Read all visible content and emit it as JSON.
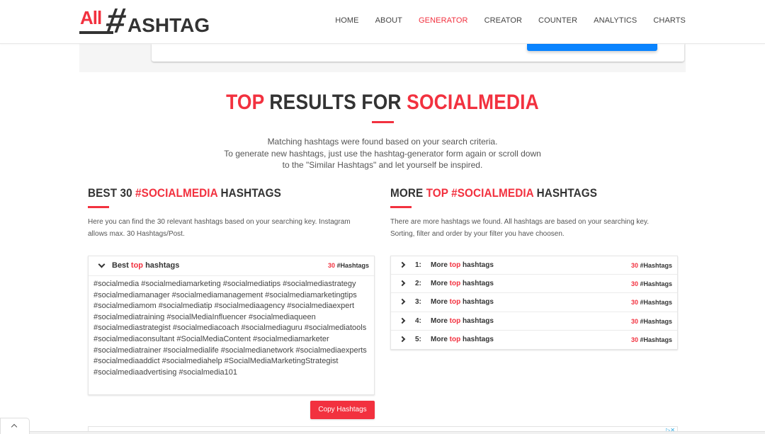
{
  "header": {
    "logo": {
      "all": "All",
      "hash": "#",
      "rest": "ASHTAG"
    },
    "nav": [
      {
        "label": "HOME",
        "active": false
      },
      {
        "label": "ABOUT",
        "active": false
      },
      {
        "label": "GENERATOR",
        "active": true
      },
      {
        "label": "CREATOR",
        "active": false
      },
      {
        "label": "COUNTER",
        "active": false
      },
      {
        "label": "ANALYTICS",
        "active": false
      },
      {
        "label": "CHARTS",
        "active": false
      }
    ]
  },
  "main": {
    "title": {
      "part1": "TOP",
      "part2": " RESULTS FOR ",
      "part3": "SOCIALMEDIA"
    },
    "intro": {
      "line1": "Matching hashtags were found based on your search criteria.",
      "line2": "To generate new hashtags, just use the hashtag-generator form again or scroll down",
      "line3": "to the \"Similar Hashtags\" and let yourself be inspired."
    }
  },
  "best": {
    "title": {
      "part1": "BEST 30 ",
      "part2": "#SOCIALMEDIA",
      "part3": " HASHTAGS"
    },
    "description": "Here you can find the 30 relevant hashtags based on your searching key. Instagram allows max. 30 Hashtags/Post.",
    "box": {
      "label": {
        "part1": "Best ",
        "part2": "top",
        "part3": " hashtags"
      },
      "count": "30",
      "count_suffix": " #Hashtags",
      "tags": "#socialmedia #socialmediamarketing #socialmediatips #socialmediastrategy #socialmediamanager #socialmediamanagement #socialmediamarketingtips #socialmediamom #socialmediatip #socialmediaagency #socialmediaexpert #socialmediatraining #socialMediaInfluencer #socialmediaqueen #socialmediastrategist #socialmediacoach #socialmediaguru #socialmediatools #socialmediaconsultant #SocialMediaContent #socialmediamarketer #socialmediatrainer #socialmedialife #socialmedianetwork #socialmediaexperts #socialmediaaddict #socialmediahelp #SocialMediaMarketingStrategist #socialmediaadvertising #socialmedia101"
    },
    "copy_button": "Copy Hashtags"
  },
  "more": {
    "title": {
      "part1": "MORE ",
      "part2": "TOP #SOCIALMEDIA",
      "part3": " HASHTAGS"
    },
    "description": "There are more hashtags we found. All hashtags are based on your searching key. Sorting, filter and order by your filter you have choosen.",
    "items": [
      {
        "num": "1:",
        "label1": "More ",
        "label2": "top",
        "label3": " hashtags",
        "count": "30",
        "suffix": " #Hashtags"
      },
      {
        "num": "2:",
        "label1": "More ",
        "label2": "top",
        "label3": " hashtags",
        "count": "30",
        "suffix": " #Hashtags"
      },
      {
        "num": "3:",
        "label1": "More ",
        "label2": "top",
        "label3": " hashtags",
        "count": "30",
        "suffix": " #Hashtags"
      },
      {
        "num": "4:",
        "label1": "More ",
        "label2": "top",
        "label3": " hashtags",
        "count": "30",
        "suffix": " #Hashtags"
      },
      {
        "num": "5:",
        "label1": "More ",
        "label2": "top",
        "label3": " hashtags",
        "count": "30",
        "suffix": " #Hashtags"
      }
    ]
  },
  "colors": {
    "accent": "#f2313f",
    "primary_button": "#0a84ff",
    "text": "#333333"
  }
}
